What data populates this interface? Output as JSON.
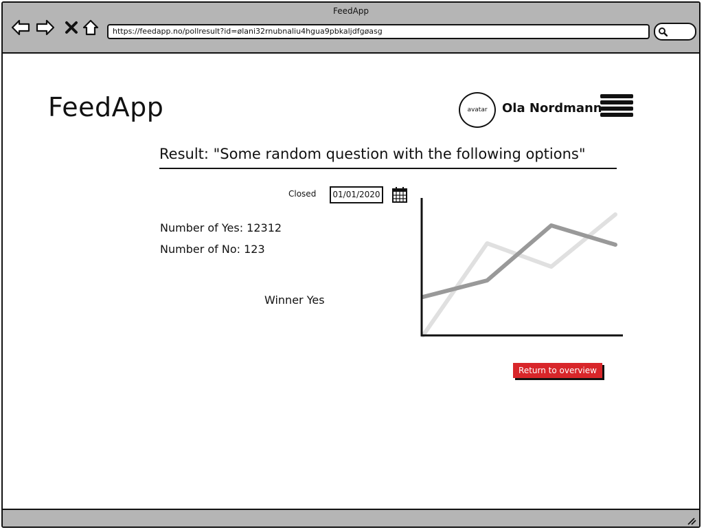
{
  "window": {
    "title": "FeedApp",
    "url": "https://feedapp.no/pollresult?id=ølani32rnubnaliu4hgua9pbkaljdfgøasg"
  },
  "header": {
    "brand": "FeedApp",
    "avatar_label": "avatar",
    "username": "Ola Nordmann"
  },
  "result": {
    "title": "Result: \"Some random question with the following options\"",
    "closed_label": "Closed",
    "closed_date": "01/01/2020",
    "yes_count_text": "Number of Yes: 12312",
    "no_count_text": "Number of No: 123",
    "winner_text": "Winner Yes",
    "return_button": "Return to overview"
  },
  "chart_data": {
    "type": "line",
    "x": [
      0,
      1,
      2,
      3
    ],
    "series": [
      {
        "values": [
          0,
          67,
          50,
          88
        ],
        "color": "#e0e0e0"
      },
      {
        "values": [
          28,
          40,
          80,
          66
        ],
        "color": "#999999"
      }
    ],
    "ylim": [
      0,
      100
    ],
    "xlabel": "",
    "ylabel": "",
    "grid": false
  }
}
